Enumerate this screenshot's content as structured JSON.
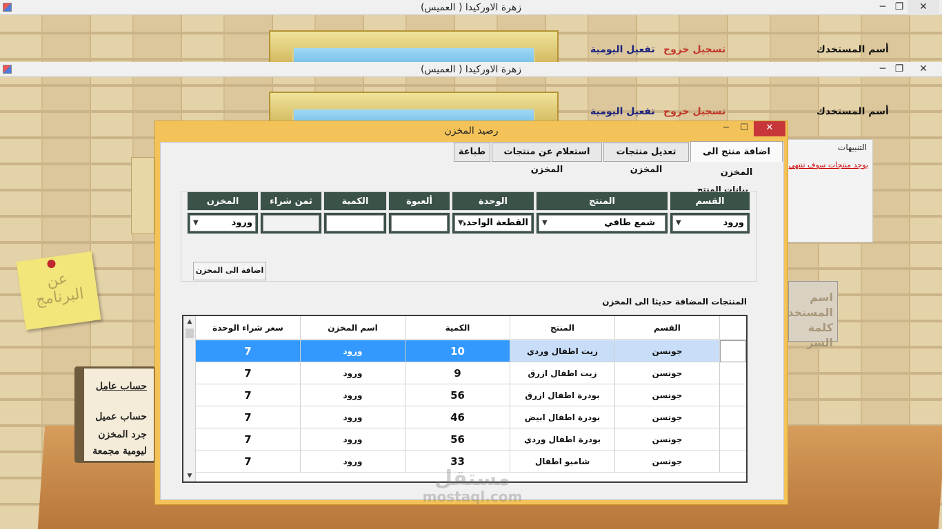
{
  "window": {
    "title": "زهرة الاوركيدا ( العميس)",
    "minimize": "─",
    "restore": "❐",
    "close": "✕"
  },
  "topbar": {
    "username_label": "أسم المستخدك",
    "logout": "تسجيل خروج",
    "activate_daily": "تفعيل اليومية"
  },
  "notice_panel": {
    "title": "التنبيهات",
    "link": "يوجد منتجات سوف تنتهي"
  },
  "sticky_note": "عن البرنامج",
  "plaque": "اسم المستخدم كلمة السر",
  "book_menu": [
    "حساب عامل",
    "حساب عميل",
    "جرد المخزن",
    "ليومية مجمعة"
  ],
  "dialog": {
    "title": "رصيد المخزن",
    "controls": {
      "minimize": "─",
      "maximize": "☐",
      "close": "✕"
    },
    "tabs": [
      {
        "label": "اضافة منتج الى المخزن",
        "active": true
      },
      {
        "label": "تعديل منتجات المخزن",
        "active": false
      },
      {
        "label": "استعلام عن منتجات المخزن",
        "active": false
      },
      {
        "label": "طباعة",
        "active": false
      }
    ],
    "product_group": {
      "caption": "بيانات المنتج",
      "headers": {
        "section": "القسم",
        "product": "المنتج",
        "unit": "الوحدة",
        "package": "ألعبوة",
        "quantity": "الكمية",
        "purchase_price": "ثمن شراء",
        "store": "المخزن"
      },
      "values": {
        "section": "ورود",
        "product": "شمع طافي",
        "unit": "القطعة الواحدة",
        "package": "",
        "quantity": "",
        "purchase_price": "",
        "store": "ورود"
      },
      "add_button": "اضافة الى المخزن"
    },
    "added_group": {
      "caption": "المنتجات المضافة حديثا الى المخزن",
      "columns": [
        "القسم",
        "المنتج",
        "الكمية",
        "اسم المخزن",
        "سعر شراء الوحدة"
      ],
      "rows": [
        {
          "section": "جونسن",
          "product": "زيت اطفال وردي",
          "qty": "10",
          "store": "ورود",
          "price": "7",
          "selected": true
        },
        {
          "section": "جونسن",
          "product": "زيت اطفال ازرق",
          "qty": "9",
          "store": "ورود",
          "price": "7"
        },
        {
          "section": "جونسن",
          "product": "بودرة اطفال ازرق",
          "qty": "56",
          "store": "ورود",
          "price": "7"
        },
        {
          "section": "جونسن",
          "product": "بودرة اطفال ابيض",
          "qty": "46",
          "store": "ورود",
          "price": "7"
        },
        {
          "section": "جونسن",
          "product": "بودرة اطفال وردي",
          "qty": "56",
          "store": "ورود",
          "price": "7"
        },
        {
          "section": "جونسن",
          "product": "شامبو اطفال",
          "qty": "33",
          "store": "ورود",
          "price": "7"
        }
      ]
    }
  },
  "watermark": {
    "brand": "مستقل",
    "site": "mostaql.com"
  },
  "colors": {
    "dialog_frame": "#f3c35a",
    "header_bg": "#3a5248",
    "selected_row": "#3399ff",
    "logout": "#c0392b",
    "activate": "#1a237e"
  }
}
